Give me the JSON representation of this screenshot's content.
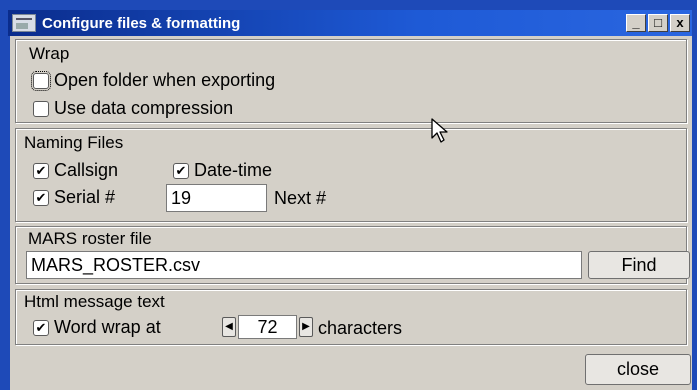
{
  "window": {
    "title": "Configure files & formatting",
    "controls": {
      "minimize": "_",
      "maximize": "□",
      "close": "x"
    }
  },
  "wrap": {
    "title": "Wrap",
    "open_folder": {
      "label": "Open folder when exporting",
      "checked": false
    },
    "compression": {
      "label": "Use data compression",
      "checked": false
    }
  },
  "naming": {
    "title": "Naming Files",
    "callsign": {
      "label": "Callsign",
      "checked": true
    },
    "datetime": {
      "label": "Date-time",
      "checked": true
    },
    "serial": {
      "label": "Serial #",
      "checked": true
    },
    "next_value": "19",
    "next_label": "Next #"
  },
  "roster": {
    "title": "MARS roster file",
    "file": "MARS_ROSTER.csv",
    "find_label": "Find"
  },
  "html": {
    "title": "Html message text",
    "wordwrap": {
      "label": "Word wrap at",
      "checked": true
    },
    "chars_value": "72",
    "chars_label": "characters"
  },
  "footer": {
    "close_label": "close"
  },
  "icons": {
    "check": "✔",
    "left": "◀",
    "right": "▶"
  }
}
